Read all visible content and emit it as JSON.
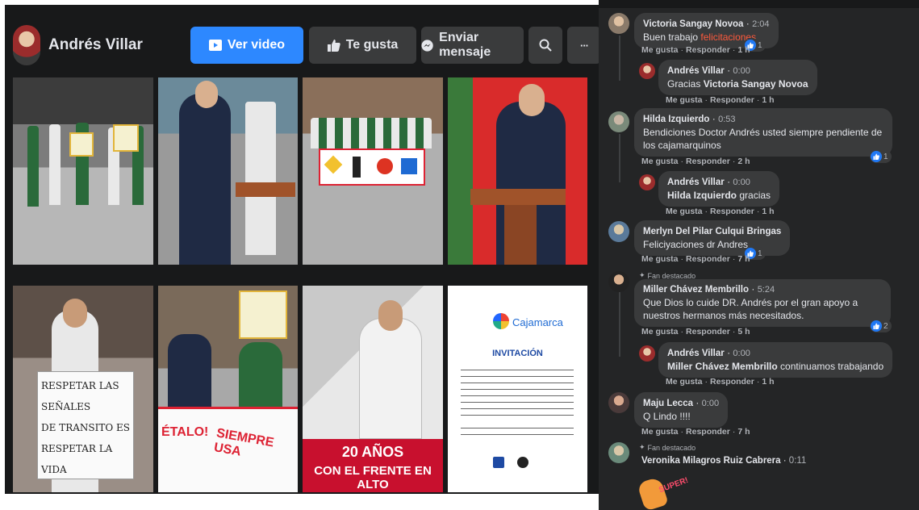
{
  "page": {
    "name": "Andrés Villar",
    "buttons": {
      "watch": "Ver video",
      "like": "Te gusta",
      "message": "Enviar mensaje",
      "more": "···"
    }
  },
  "photos": {
    "tile8": {
      "headline_line1": "20 AÑOS",
      "headline_line2": "CON EL FRENTE EN ALTO",
      "banner_text": "ÉTALO!",
      "banner_text2": "SIEMPRE USA"
    },
    "sign_text": [
      "RESPETAR LAS SEÑALES",
      "DE TRANSITO ES",
      "RESPETAR LA VIDA"
    ],
    "invitation": {
      "logo": "Cajamarca",
      "title": "INVITACIÓN"
    }
  },
  "comments": [
    {
      "author": "Victoria Sangay Novoa",
      "time": "2:04",
      "text": "Buen trabajo ",
      "highlight": "felicitaciones",
      "actions": {
        "like": "Me gusta",
        "reply": "Responder",
        "age": "1 h"
      },
      "reactions": "1",
      "reply": {
        "author": "Andrés Villar",
        "time": "0:00",
        "text_prefix": "Gracias ",
        "mention": "Victoria Sangay Novoa",
        "actions": {
          "like": "Me gusta",
          "reply": "Responder",
          "age": "1 h"
        }
      }
    },
    {
      "author": "Hilda Izquierdo",
      "time": "0:53",
      "text": "Bendiciones Doctor Andrés usted siempre pendiente de los cajamarquinos",
      "actions": {
        "like": "Me gusta",
        "reply": "Responder",
        "age": "2 h"
      },
      "reactions": "1",
      "reply": {
        "author": "Andrés Villar",
        "time": "0:00",
        "mention": "Hilda Izquierdo",
        "text_suffix": " gracias",
        "actions": {
          "like": "Me gusta",
          "reply": "Responder",
          "age": "1 h"
        }
      }
    },
    {
      "author": "Merlyn Del Pilar Culqui Bringas",
      "text": "Feliciyaciones dr Andres",
      "actions": {
        "like": "Me gusta",
        "reply": "Responder",
        "age": "7 h"
      },
      "reactions": "1"
    },
    {
      "badge": "Fan destacado",
      "author": "Miller Chávez Membrillo",
      "time": "5:24",
      "text": "Que Dios lo cuide DR. Andrés por el gran apoyo a nuestros hermanos más necesitados.",
      "actions": {
        "like": "Me gusta",
        "reply": "Responder",
        "age": "5 h"
      },
      "reactions": "2",
      "reply": {
        "author": "Andrés Villar",
        "time": "0:00",
        "mention": "Miller Chávez Membrillo",
        "text_suffix": " continuamos trabajando",
        "actions": {
          "like": "Me gusta",
          "reply": "Responder",
          "age": "1 h"
        }
      }
    },
    {
      "author": "Maju Lecca",
      "time": "0:00",
      "text": "Q Lindo !!!!",
      "actions": {
        "like": "Me gusta",
        "reply": "Responder",
        "age": "7 h"
      }
    },
    {
      "badge": "Fan destacado",
      "author": "Veronika Milagros Ruiz Cabrera",
      "time": "0:11",
      "sticker_text": "SUPER!"
    }
  ],
  "colors": {
    "accent": "#2d88ff",
    "highlight": "#ff5a3c",
    "like_blue": "#2078f4",
    "dark_bg": "#18191a",
    "panel_bg": "#242526",
    "bubble_bg": "#3a3b3c"
  },
  "icons": [
    "video-icon",
    "thumbs-up-icon",
    "messenger-icon",
    "search-icon",
    "more-icon",
    "like-reaction-icon",
    "fan-badge-icon"
  ]
}
